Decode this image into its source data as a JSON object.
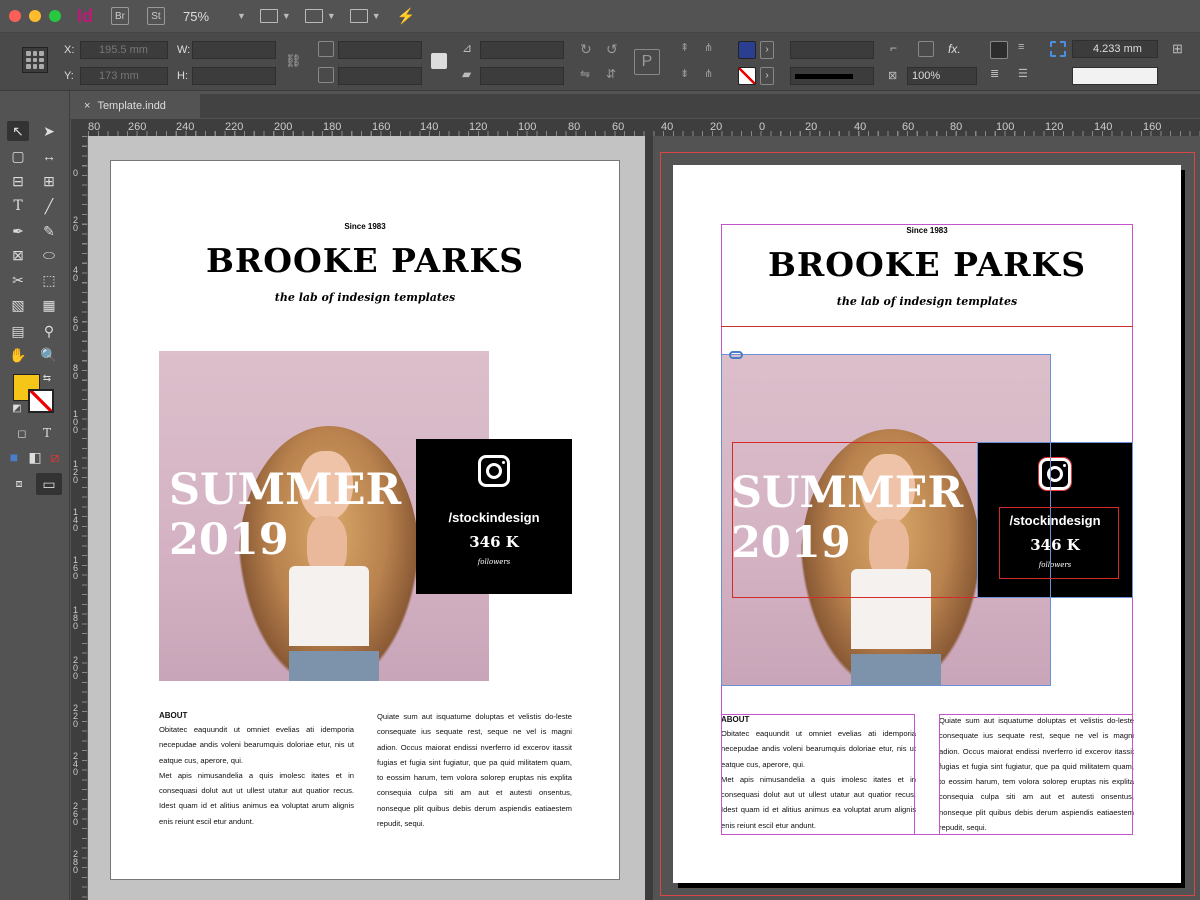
{
  "app": {
    "icon_label": "Id",
    "bridge_label": "Br",
    "stock_label": "St",
    "zoom": "75%"
  },
  "control_panel": {
    "x_label": "X:",
    "y_label": "Y:",
    "w_label": "W:",
    "h_label": "H:",
    "x_value": "195.5 mm",
    "y_value": "173 mm",
    "scale_value": "100%",
    "stroke_weight": "4.233 mm",
    "fx_label": "fx.",
    "fill_color": "#2a3f8f"
  },
  "document_tab": {
    "close": "×",
    "name": "Template.indd"
  },
  "ruler": {
    "h_labels": [
      "80",
      "260",
      "240",
      "220",
      "200",
      "180",
      "160",
      "140",
      "120",
      "100",
      "80",
      "60",
      "40",
      "20",
      "0",
      "20",
      "40",
      "60",
      "80",
      "100",
      "120",
      "140",
      "160"
    ],
    "v_labels": [
      "0",
      "2 0",
      "4 0",
      "6 0",
      "8 0",
      "1 0 0",
      "1 2 0",
      "1 4 0",
      "1 6 0",
      "1 8 0",
      "2 0 0",
      "2 2 0",
      "2 4 0",
      "2 6 0",
      "2 8 0"
    ]
  },
  "toolbar": {
    "type_tool": "T",
    "swatch_fill": "#f5c518"
  },
  "layout": {
    "since": "Since 1983",
    "title": "BROOKE PARKS",
    "tagline": "the lab of indesign templates",
    "headline_line1": "SUMMER",
    "headline_line2": "2019",
    "instagram_handle": "/stockindesign",
    "followers_count": "346 K",
    "followers_label": "followers",
    "about_heading": "ABOUT",
    "about_p1": "Obitatec eaquundit ut omniet evelias ati idemporia necepudae andis voleni bearumquis doloriae etur, nis ut eatque cus, aperore, qui.",
    "about_p2": "Met apis nimusandelia a quis imolesc itates et in consequasi dolut aut ut ullest utatur aut quatior recus. Idest quam id et alitius animus ea voluptat arum alignis enis reiunt escil etur andunt.",
    "col2_text": "Quiate sum aut isquatume doluptas et velistis do-leste consequate ius sequate rest, seque ne vel is magni adion. Occus maiorat endissi nverferro id excerov itassit fugias et fugia sint fugiatur, que pa quid militatem quam, to eossim harum, tem volora solorep eruptas nis explita consequia culpa siti am aut et autesti onsentus, nonseque plit quibus debis derum aspiendis eatiaestem repudit, sequi."
  }
}
